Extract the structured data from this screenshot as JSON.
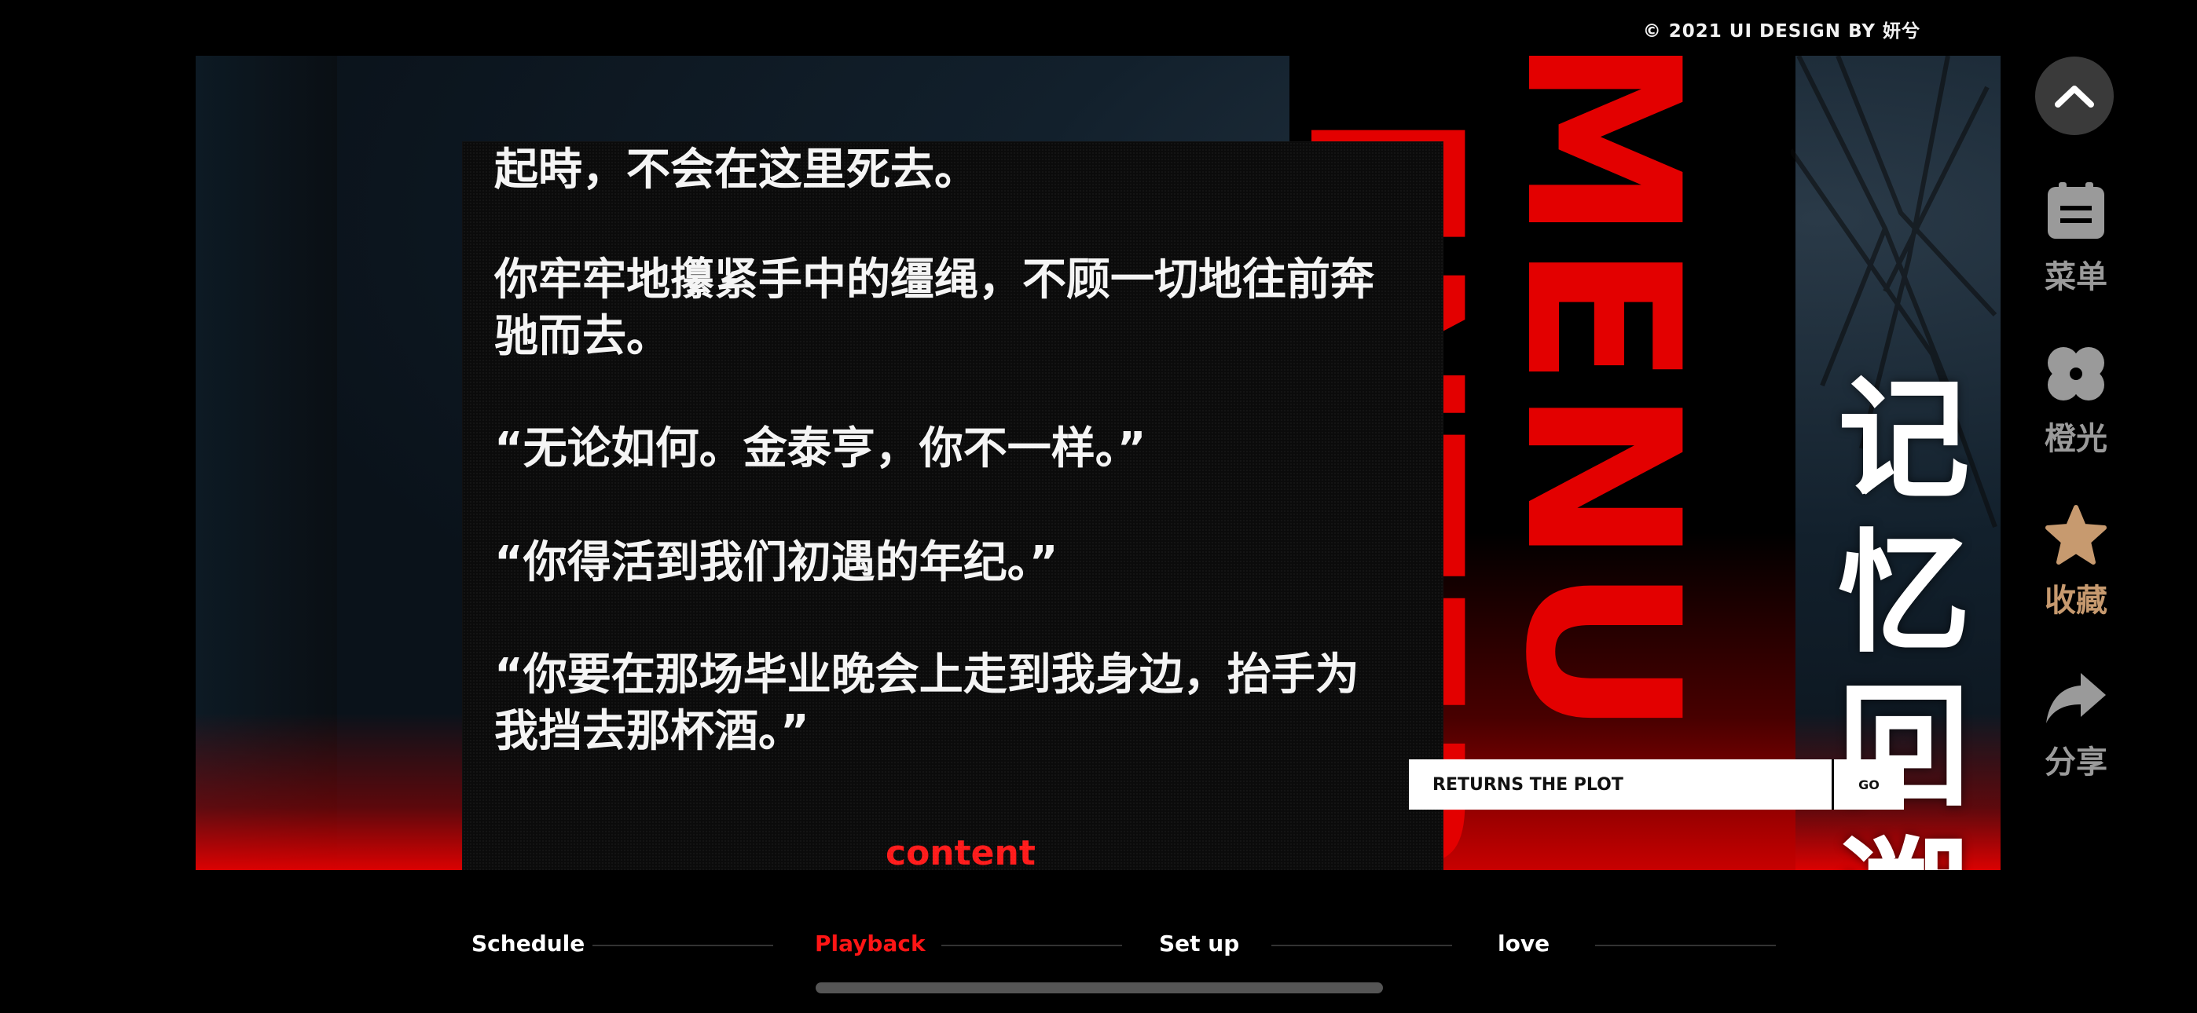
{
  "credit": "© 2021 UI DESIGN BY 妍兮",
  "background": {
    "word_top": "MENU",
    "word_bottom": "ENTER"
  },
  "story": {
    "paragraphs": [
      "起時，不会在这里死去。",
      "你牢牢地攥紧手中的缰绳，不顾一切地往前奔驰而去。",
      "“无论如何。金泰亨，你不一样。”",
      "“你得活到我们初遇的年纪。”",
      "“你要在那场毕业晚会上走到我身边，抬手为我挡去那杯酒。”"
    ],
    "content_link": "content"
  },
  "title": {
    "line1": "记忆",
    "line2": "回溯"
  },
  "search": {
    "label": "RETURNS THE PLOT",
    "go": "GO"
  },
  "side_actions": [
    {
      "label": "菜单",
      "icon": "menu-card-icon"
    },
    {
      "label": "橙光",
      "icon": "clover-icon"
    },
    {
      "label": "收藏",
      "icon": "star-icon"
    },
    {
      "label": "分享",
      "icon": "share-arrow-icon"
    }
  ],
  "tabs": [
    {
      "label": "Schedule"
    },
    {
      "label": "Playback"
    },
    {
      "label": "Set up"
    },
    {
      "label": "love"
    }
  ],
  "active_tab": "Playback",
  "colors": {
    "accent_red": "#e30000",
    "collect_gold": "#c79a6f"
  }
}
